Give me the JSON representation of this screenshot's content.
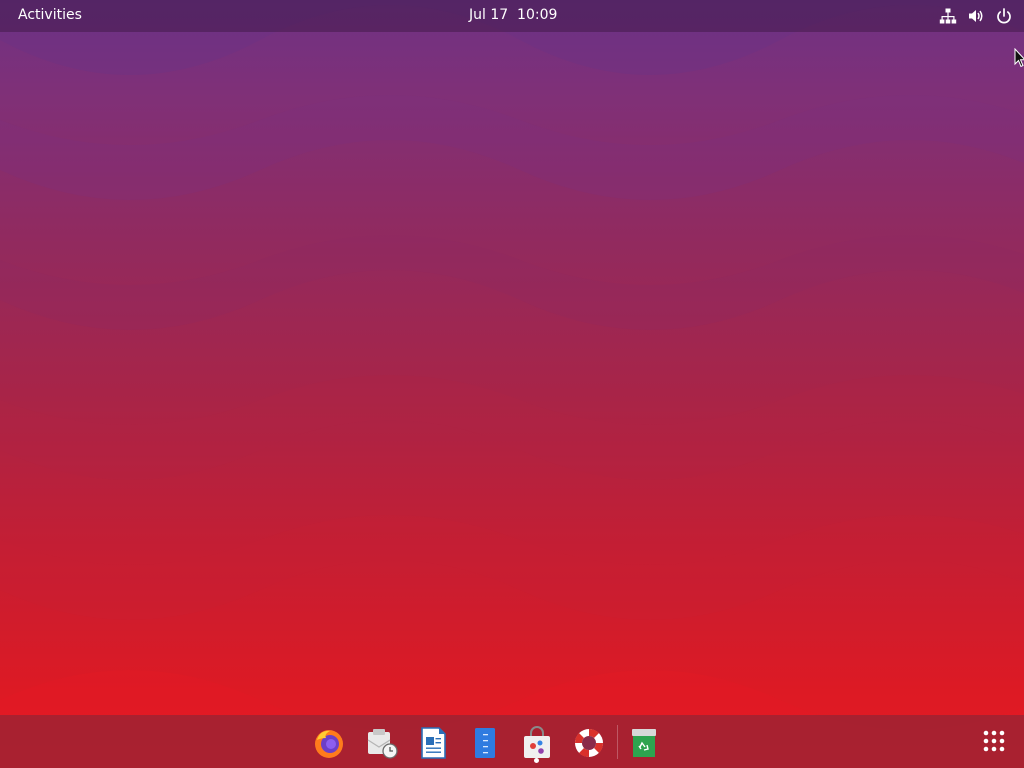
{
  "topbar": {
    "activities_label": "Activities",
    "clock_text": "Jul 17  10:09",
    "tray_icons": [
      "network-wired-icon",
      "volume-icon",
      "power-icon"
    ]
  },
  "desktop": {
    "wallpaper": "ubuntu-purple-red-waves",
    "colors": {
      "top": "#6e3284",
      "bottom": "#e51a22"
    }
  },
  "dock": {
    "items": [
      {
        "name": "firefox",
        "icon": "firefox-icon"
      },
      {
        "name": "mail-scheduler",
        "icon": "mail-clock-icon"
      },
      {
        "name": "libreoffice-writer",
        "icon": "document-writer-icon"
      },
      {
        "name": "document-viewer",
        "icon": "document-blue-icon"
      },
      {
        "name": "software-center",
        "icon": "shopping-bag-icon",
        "running": true
      },
      {
        "name": "help",
        "icon": "lifebuoy-icon"
      },
      {
        "name": "trash",
        "icon": "trash-icon"
      }
    ],
    "show_apps_icon": "app-grid-icon"
  }
}
